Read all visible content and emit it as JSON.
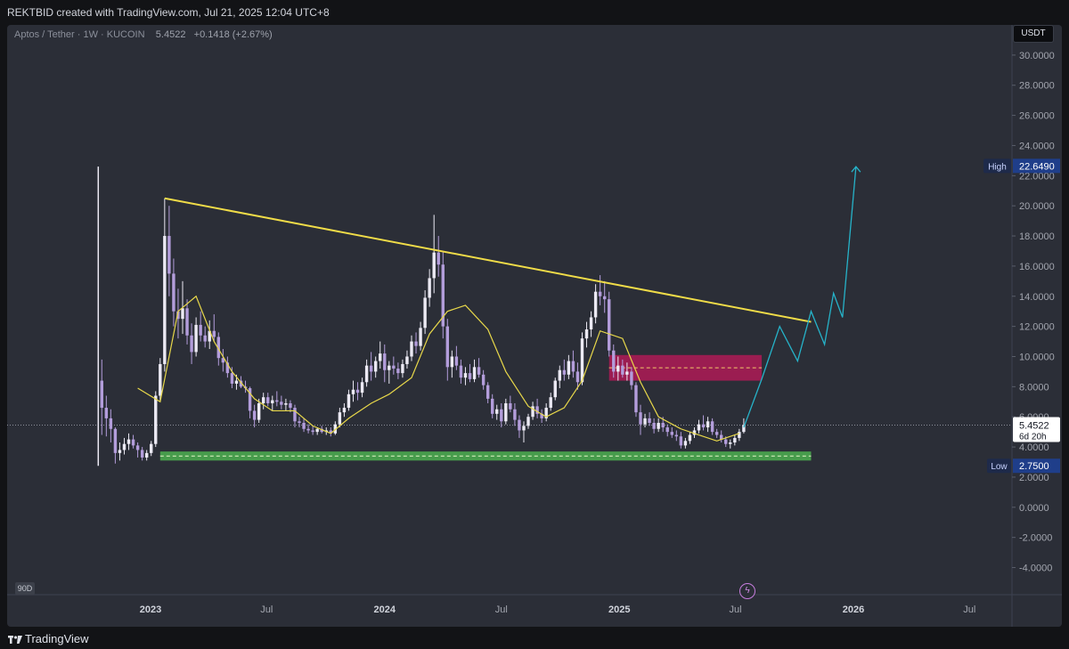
{
  "header": {
    "attribution": "REKTBID created with TradingView.com, Jul 21, 2025 12:04 UTC+8"
  },
  "symbol": {
    "name": "Aptos / Tether",
    "interval": "1W",
    "exchange": "KUCOIN",
    "price": "5.4522",
    "change": "+0.1418 (+2.67%)",
    "currency": "USDT"
  },
  "badges": {
    "range": "90D"
  },
  "footer": {
    "brand": "TradingView"
  },
  "colors": {
    "background": "#2b2e37",
    "candle": "#b39ddb",
    "ma": "#e8d84a",
    "trendline": "#f0dc48",
    "support": "#4caf50",
    "resistance": "#c2185b",
    "projection": "#26b3c9"
  },
  "chart_data": {
    "type": "candlestick",
    "y_axis": {
      "ylim": [
        -5.8,
        32.0
      ],
      "ticks": [
        "30.0000",
        "28.0000",
        "26.0000",
        "24.0000",
        "22.0000",
        "20.0000",
        "18.0000",
        "16.0000",
        "14.0000",
        "12.0000",
        "10.0000",
        "8.0000",
        "6.0000",
        "4.0000",
        "2.0000",
        "0.0000",
        "-2.0000",
        "-4.0000"
      ]
    },
    "x_axis": {
      "ticks": [
        "2023",
        "Jul",
        "2024",
        "Jul",
        "2025",
        "Jul",
        "2026",
        "Jul"
      ],
      "tick_dates": [
        "2023-01-01",
        "2023-07-01",
        "2024-01-01",
        "2024-07-01",
        "2025-01-01",
        "2025-07-01",
        "2026-01-01",
        "2026-07-01"
      ]
    },
    "price_labels": {
      "current": {
        "value": "5.4522",
        "countdown": "6d 20h",
        "level": 5.45
      },
      "high": {
        "label": "High",
        "value": "22.6490",
        "level": 22.649
      },
      "low": {
        "label": "Low",
        "value": "2.7500",
        "level": 2.75
      }
    },
    "trendline": {
      "points": [
        [
          "2023-01-23",
          20.5
        ],
        [
          "2025-10-27",
          12.3
        ]
      ]
    },
    "support_zone": {
      "x": [
        "2023-01-16",
        "2025-10-27"
      ],
      "y": [
        3.1,
        3.7
      ]
    },
    "resistance_zone": {
      "x": [
        "2024-12-16",
        "2025-08-11"
      ],
      "y": [
        8.4,
        10.1
      ],
      "mid": 9.25
    },
    "moving_average": {
      "dates": [
        "2022-12-12",
        "2023-01-16",
        "2023-02-13",
        "2023-03-13",
        "2023-04-10",
        "2023-05-08",
        "2023-06-12",
        "2023-07-10",
        "2023-08-14",
        "2023-09-11",
        "2023-10-09",
        "2023-11-06",
        "2023-12-11",
        "2024-01-08",
        "2024-02-12",
        "2024-03-11",
        "2024-04-08",
        "2024-05-06",
        "2024-06-10",
        "2024-07-08",
        "2024-08-12",
        "2024-09-09",
        "2024-10-07",
        "2024-11-04",
        "2024-12-02",
        "2025-01-06",
        "2025-02-03",
        "2025-03-03",
        "2025-04-07",
        "2025-05-05",
        "2025-06-02",
        "2025-07-07"
      ],
      "values": [
        7.9,
        7.0,
        13.0,
        14.0,
        11.0,
        9.0,
        7.2,
        6.4,
        6.4,
        5.4,
        4.9,
        5.9,
        6.9,
        7.5,
        8.6,
        11.5,
        13.0,
        13.4,
        11.8,
        9.0,
        6.7,
        6.0,
        6.6,
        8.4,
        11.7,
        11.2,
        8.3,
        6.0,
        5.2,
        4.8,
        4.4,
        4.9
      ]
    },
    "projection": {
      "dates": [
        "2025-07-14",
        "2025-08-11",
        "2025-09-08",
        "2025-10-06",
        "2025-10-27",
        "2025-11-17",
        "2025-12-01",
        "2025-12-15",
        "2026-01-05"
      ],
      "values": [
        5.3,
        8.5,
        12.0,
        9.7,
        13.0,
        10.8,
        14.2,
        12.6,
        22.6
      ]
    },
    "candles": [
      [
        "2022-10-17",
        8.4,
        9.8,
        4.8,
        6.6
      ],
      [
        "2022-10-24",
        6.6,
        7.4,
        4.7,
        5.9
      ],
      [
        "2022-10-31",
        5.9,
        6.5,
        4.3,
        5.2
      ],
      [
        "2022-11-07",
        5.2,
        5.3,
        2.9,
        3.6
      ],
      [
        "2022-11-14",
        3.6,
        4.3,
        3.1,
        3.8
      ],
      [
        "2022-11-21",
        3.8,
        4.6,
        3.5,
        4.2
      ],
      [
        "2022-11-28",
        4.2,
        4.9,
        3.8,
        4.5
      ],
      [
        "2022-12-05",
        4.5,
        4.8,
        3.9,
        4.1
      ],
      [
        "2022-12-12",
        4.1,
        4.3,
        3.3,
        3.8
      ],
      [
        "2022-12-19",
        3.8,
        4.0,
        3.1,
        3.3
      ],
      [
        "2022-12-26",
        3.3,
        3.8,
        3.1,
        3.6
      ],
      [
        "2023-01-02",
        3.6,
        4.4,
        3.4,
        4.2
      ],
      [
        "2023-01-09",
        4.2,
        7.7,
        4.0,
        7.4
      ],
      [
        "2023-01-16",
        7.4,
        9.9,
        7.0,
        9.5
      ],
      [
        "2023-01-23",
        9.5,
        20.5,
        9.0,
        18.0
      ],
      [
        "2023-01-30",
        18.0,
        20.0,
        14.0,
        15.5
      ],
      [
        "2023-02-06",
        15.5,
        16.5,
        12.0,
        13.0
      ],
      [
        "2023-02-13",
        13.0,
        14.5,
        11.2,
        12.5
      ],
      [
        "2023-02-20",
        12.5,
        15.0,
        11.5,
        13.2
      ],
      [
        "2023-02-27",
        13.2,
        13.8,
        10.8,
        11.4
      ],
      [
        "2023-03-06",
        11.4,
        12.2,
        9.5,
        10.3
      ],
      [
        "2023-03-13",
        10.3,
        12.6,
        10.0,
        12.1
      ],
      [
        "2023-03-20",
        12.1,
        13.0,
        11.0,
        11.4
      ],
      [
        "2023-03-27",
        11.4,
        12.0,
        10.6,
        11.0
      ],
      [
        "2023-04-03",
        11.0,
        12.4,
        10.5,
        11.7
      ],
      [
        "2023-04-10",
        11.7,
        12.8,
        11.0,
        11.3
      ],
      [
        "2023-04-17",
        11.3,
        11.6,
        9.4,
        9.9
      ],
      [
        "2023-04-24",
        9.9,
        10.5,
        9.0,
        9.6
      ],
      [
        "2023-05-01",
        9.6,
        10.0,
        8.6,
        8.9
      ],
      [
        "2023-05-08",
        8.9,
        9.3,
        7.9,
        8.2
      ],
      [
        "2023-05-15",
        8.2,
        8.8,
        7.8,
        8.4
      ],
      [
        "2023-05-22",
        8.4,
        8.7,
        7.9,
        8.0
      ],
      [
        "2023-05-29",
        8.0,
        8.4,
        7.6,
        7.9
      ],
      [
        "2023-06-05",
        7.9,
        8.0,
        5.9,
        6.4
      ],
      [
        "2023-06-12",
        6.4,
        6.8,
        5.3,
        5.8
      ],
      [
        "2023-06-19",
        5.8,
        7.2,
        5.6,
        6.9
      ],
      [
        "2023-06-26",
        6.9,
        7.6,
        6.5,
        7.3
      ],
      [
        "2023-07-03",
        7.3,
        7.6,
        6.7,
        6.9
      ],
      [
        "2023-07-10",
        6.9,
        7.4,
        6.4,
        7.1
      ],
      [
        "2023-07-17",
        7.1,
        7.7,
        6.7,
        7.0
      ],
      [
        "2023-07-24",
        7.0,
        7.4,
        6.5,
        6.8
      ],
      [
        "2023-07-31",
        6.8,
        7.2,
        6.4,
        6.9
      ],
      [
        "2023-08-07",
        6.9,
        7.1,
        6.3,
        6.6
      ],
      [
        "2023-08-14",
        6.6,
        6.8,
        5.3,
        5.7
      ],
      [
        "2023-08-21",
        5.7,
        6.0,
        5.3,
        5.6
      ],
      [
        "2023-08-28",
        5.6,
        5.9,
        5.0,
        5.2
      ],
      [
        "2023-09-04",
        5.2,
        5.5,
        4.9,
        5.1
      ],
      [
        "2023-09-11",
        5.1,
        5.4,
        4.8,
        5.0
      ],
      [
        "2023-09-18",
        5.0,
        5.3,
        4.8,
        5.2
      ],
      [
        "2023-09-25",
        5.2,
        5.4,
        4.9,
        5.0
      ],
      [
        "2023-10-02",
        5.0,
        5.3,
        4.8,
        5.1
      ],
      [
        "2023-10-09",
        5.1,
        5.3,
        4.7,
        4.9
      ],
      [
        "2023-10-16",
        4.9,
        5.7,
        4.8,
        5.5
      ],
      [
        "2023-10-23",
        5.5,
        6.6,
        5.3,
        6.3
      ],
      [
        "2023-10-30",
        6.3,
        6.9,
        6.0,
        6.6
      ],
      [
        "2023-11-06",
        6.6,
        7.8,
        6.4,
        7.5
      ],
      [
        "2023-11-13",
        7.5,
        8.4,
        7.0,
        7.8
      ],
      [
        "2023-11-20",
        7.8,
        8.3,
        7.1,
        7.6
      ],
      [
        "2023-11-27",
        7.6,
        8.6,
        7.3,
        8.3
      ],
      [
        "2023-12-04",
        8.3,
        9.8,
        8.0,
        9.4
      ],
      [
        "2023-12-11",
        9.4,
        10.3,
        8.4,
        9.0
      ],
      [
        "2023-12-18",
        9.0,
        10.0,
        8.6,
        9.7
      ],
      [
        "2023-12-25",
        9.7,
        11.0,
        9.2,
        10.2
      ],
      [
        "2024-01-01",
        10.2,
        10.8,
        8.3,
        9.1
      ],
      [
        "2024-01-08",
        9.1,
        9.7,
        8.2,
        9.4
      ],
      [
        "2024-01-15",
        9.4,
        10.0,
        8.8,
        9.2
      ],
      [
        "2024-01-22",
        9.2,
        9.6,
        8.5,
        8.9
      ],
      [
        "2024-01-29",
        8.9,
        9.8,
        8.6,
        9.5
      ],
      [
        "2024-02-05",
        9.5,
        10.4,
        9.2,
        10.0
      ],
      [
        "2024-02-12",
        10.0,
        11.4,
        9.7,
        11.0
      ],
      [
        "2024-02-19",
        11.0,
        11.6,
        10.2,
        10.7
      ],
      [
        "2024-02-26",
        10.7,
        12.3,
        10.4,
        11.9
      ],
      [
        "2024-03-04",
        11.9,
        14.4,
        11.5,
        13.9
      ],
      [
        "2024-03-11",
        13.9,
        15.8,
        13.3,
        15.2
      ],
      [
        "2024-03-18",
        15.2,
        19.4,
        14.2,
        16.9
      ],
      [
        "2024-03-25",
        16.9,
        18.0,
        15.3,
        16.1
      ],
      [
        "2024-04-01",
        16.1,
        17.0,
        11.2,
        12.0
      ],
      [
        "2024-04-08",
        12.0,
        12.5,
        8.4,
        9.3
      ],
      [
        "2024-04-15",
        9.3,
        10.4,
        8.6,
        10.0
      ],
      [
        "2024-04-22",
        10.0,
        10.7,
        9.1,
        9.4
      ],
      [
        "2024-04-29",
        9.4,
        9.8,
        8.2,
        8.6
      ],
      [
        "2024-05-06",
        8.6,
        9.3,
        8.1,
        8.9
      ],
      [
        "2024-05-13",
        8.9,
        9.5,
        8.3,
        8.5
      ],
      [
        "2024-05-20",
        8.5,
        9.8,
        8.3,
        9.3
      ],
      [
        "2024-05-27",
        9.3,
        9.9,
        8.6,
        8.8
      ],
      [
        "2024-06-03",
        8.8,
        9.1,
        7.8,
        8.1
      ],
      [
        "2024-06-10",
        8.1,
        8.3,
        6.9,
        7.2
      ],
      [
        "2024-06-17",
        7.2,
        7.5,
        5.9,
        6.2
      ],
      [
        "2024-06-24",
        6.2,
        6.8,
        5.8,
        6.5
      ],
      [
        "2024-07-01",
        6.5,
        6.9,
        5.3,
        5.7
      ],
      [
        "2024-07-08",
        5.7,
        7.2,
        5.5,
        6.9
      ],
      [
        "2024-07-15",
        6.9,
        7.4,
        6.3,
        6.5
      ],
      [
        "2024-07-22",
        6.5,
        6.9,
        5.4,
        5.8
      ],
      [
        "2024-07-29",
        5.8,
        6.1,
        4.6,
        5.1
      ],
      [
        "2024-08-05",
        5.1,
        5.7,
        4.3,
        5.4
      ],
      [
        "2024-08-12",
        5.4,
        6.2,
        5.2,
        6.0
      ],
      [
        "2024-08-19",
        6.0,
        7.0,
        5.8,
        6.7
      ],
      [
        "2024-08-26",
        6.7,
        7.2,
        5.9,
        6.2
      ],
      [
        "2024-09-02",
        6.2,
        6.5,
        5.6,
        5.9
      ],
      [
        "2024-09-09",
        5.9,
        6.9,
        5.7,
        6.6
      ],
      [
        "2024-09-16",
        6.6,
        7.6,
        6.4,
        7.3
      ],
      [
        "2024-09-23",
        7.3,
        8.6,
        7.1,
        8.4
      ],
      [
        "2024-09-30",
        8.4,
        9.4,
        7.9,
        9.1
      ],
      [
        "2024-10-07",
        9.1,
        9.8,
        8.4,
        8.8
      ],
      [
        "2024-10-14",
        8.8,
        10.1,
        8.5,
        9.7
      ],
      [
        "2024-10-21",
        9.7,
        10.4,
        8.6,
        9.0
      ],
      [
        "2024-10-28",
        9.0,
        9.6,
        7.8,
        8.3
      ],
      [
        "2024-11-04",
        8.3,
        11.6,
        8.1,
        11.2
      ],
      [
        "2024-11-11",
        11.2,
        12.3,
        10.6,
        11.8
      ],
      [
        "2024-11-18",
        11.8,
        13.0,
        11.3,
        12.6
      ],
      [
        "2024-11-25",
        12.6,
        14.8,
        12.2,
        14.3
      ],
      [
        "2024-12-02",
        14.3,
        15.4,
        13.4,
        14.0
      ],
      [
        "2024-12-09",
        14.0,
        15.0,
        12.9,
        13.8
      ],
      [
        "2024-12-16",
        13.8,
        14.3,
        10.0,
        10.4
      ],
      [
        "2024-12-23",
        10.4,
        10.8,
        8.6,
        9.0
      ],
      [
        "2024-12-30",
        9.0,
        10.0,
        8.4,
        9.4
      ],
      [
        "2025-01-06",
        9.4,
        9.8,
        8.6,
        8.8
      ],
      [
        "2025-01-13",
        8.8,
        9.6,
        8.4,
        9.0
      ],
      [
        "2025-01-20",
        9.0,
        9.3,
        7.8,
        8.1
      ],
      [
        "2025-01-27",
        8.1,
        8.3,
        6.0,
        6.3
      ],
      [
        "2025-02-03",
        6.3,
        6.8,
        4.8,
        5.5
      ],
      [
        "2025-02-10",
        5.5,
        6.2,
        5.3,
        5.9
      ],
      [
        "2025-02-17",
        5.9,
        6.3,
        5.4,
        5.6
      ],
      [
        "2025-02-24",
        5.6,
        5.9,
        4.9,
        5.2
      ],
      [
        "2025-03-03",
        5.2,
        5.9,
        5.0,
        5.6
      ],
      [
        "2025-03-10",
        5.6,
        6.0,
        5.0,
        5.3
      ],
      [
        "2025-03-17",
        5.3,
        5.5,
        4.7,
        5.0
      ],
      [
        "2025-03-24",
        5.0,
        5.3,
        4.6,
        4.8
      ],
      [
        "2025-03-31",
        4.8,
        5.1,
        4.4,
        4.7
      ],
      [
        "2025-04-07",
        4.7,
        5.0,
        3.9,
        4.1
      ],
      [
        "2025-04-14",
        4.1,
        4.6,
        3.9,
        4.4
      ],
      [
        "2025-04-21",
        4.4,
        5.0,
        4.2,
        4.8
      ],
      [
        "2025-04-28",
        4.8,
        5.3,
        4.6,
        5.1
      ],
      [
        "2025-05-05",
        5.1,
        5.8,
        4.9,
        5.5
      ],
      [
        "2025-05-12",
        5.5,
        6.1,
        5.1,
        5.3
      ],
      [
        "2025-05-19",
        5.3,
        6.0,
        5.0,
        5.7
      ],
      [
        "2025-05-26",
        5.7,
        5.9,
        4.8,
        5.0
      ],
      [
        "2025-06-02",
        5.0,
        5.2,
        4.6,
        4.8
      ],
      [
        "2025-06-09",
        4.8,
        5.1,
        4.3,
        4.5
      ],
      [
        "2025-06-16",
        4.5,
        4.7,
        4.0,
        4.2
      ],
      [
        "2025-06-23",
        4.2,
        4.5,
        3.9,
        4.3
      ],
      [
        "2025-06-30",
        4.3,
        4.8,
        4.1,
        4.6
      ],
      [
        "2025-07-07",
        4.6,
        5.2,
        4.4,
        5.0
      ],
      [
        "2025-07-14",
        5.0,
        5.9,
        4.9,
        5.45
      ]
    ]
  }
}
